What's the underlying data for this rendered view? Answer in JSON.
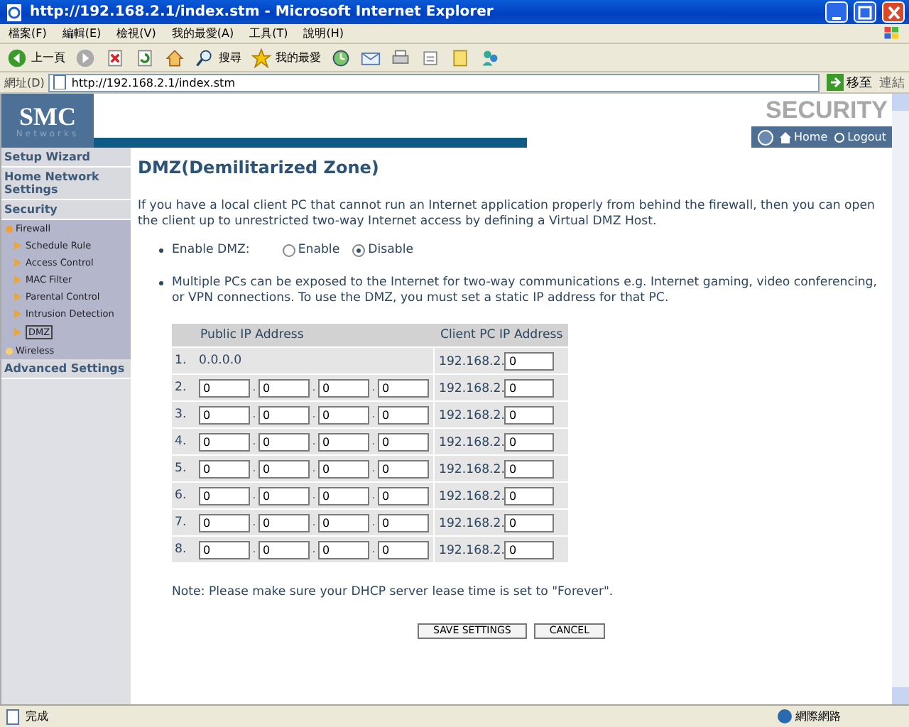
{
  "window": {
    "title": "http://192.168.2.1/index.stm - Microsoft Internet Explorer"
  },
  "menu": [
    "檔案(F)",
    "編輯(E)",
    "檢視(V)",
    "我的最愛(A)",
    "工具(T)",
    "說明(H)"
  ],
  "toolbar": [
    {
      "kind": "back",
      "label": "上一頁"
    },
    {
      "kind": "forward"
    },
    {
      "kind": "stop"
    },
    {
      "kind": "refresh"
    },
    {
      "kind": "home"
    },
    {
      "kind": "search",
      "label": "搜尋"
    },
    {
      "kind": "favorites",
      "label": "我的最愛"
    },
    {
      "kind": "history"
    },
    {
      "kind": "mail"
    },
    {
      "kind": "print"
    },
    {
      "kind": "edit"
    },
    {
      "kind": "discuss"
    },
    {
      "kind": "messenger"
    }
  ],
  "address": {
    "label": "網址(D)",
    "value": "http://192.168.2.1/index.stm",
    "go": "移至",
    "links": "連結"
  },
  "header": {
    "logo": "SMC",
    "logo_sub": "Networks",
    "banner": "SECURITY",
    "links": [
      "Home",
      "Logout"
    ]
  },
  "sidebar": [
    {
      "label": "Setup Wizard"
    },
    {
      "label": "Home Network Settings"
    },
    {
      "label": "Security",
      "children": [
        {
          "label": "Firewall",
          "expanded": true,
          "children": [
            {
              "label": "Schedule Rule",
              "selected": false
            },
            {
              "label": "Access Control",
              "selected": false
            },
            {
              "label": "MAC Filter",
              "selected": false
            },
            {
              "label": "Parental Control",
              "selected": false
            },
            {
              "label": "Intrusion Detection",
              "selected": false
            },
            {
              "label": "DMZ",
              "selected": true
            }
          ]
        },
        {
          "label": "Wireless",
          "expanded": false
        }
      ]
    },
    {
      "label": "Advanced Settings"
    }
  ],
  "content": {
    "title": "DMZ(Demilitarized Zone)",
    "intro": "If you have a local client PC that cannot run an Internet application properly from behind the firewall, then you can open the client up to unrestricted two-way Internet access by defining a Virtual DMZ Host.",
    "enable_dmz": {
      "label": "Enable DMZ:",
      "options": [
        {
          "label": "Enable",
          "selected": false
        },
        {
          "label": "Disable",
          "selected": true
        }
      ]
    },
    "info": "Multiple PCs can be exposed to the Internet for two-way communications e.g. Internet gaming, video conferencing, or VPN connections.  To use the DMZ, you must set a static IP address for that PC.",
    "table": {
      "separator": ".",
      "columns": [
        "Public IP Address",
        "Client PC IP Address"
      ],
      "rows": [
        {
          "index": "1.",
          "kind": "text",
          "public": "0.0.0.0",
          "client_prefix": "192.168.2.",
          "client": "0"
        },
        {
          "index": "2.",
          "kind": "fields",
          "public": [
            "0",
            "0",
            "0",
            "0"
          ],
          "client_prefix": "192.168.2.",
          "client": "0"
        },
        {
          "index": "3.",
          "kind": "fields",
          "public": [
            "0",
            "0",
            "0",
            "0"
          ],
          "client_prefix": "192.168.2.",
          "client": "0"
        },
        {
          "index": "4.",
          "kind": "fields",
          "public": [
            "0",
            "0",
            "0",
            "0"
          ],
          "client_prefix": "192.168.2.",
          "client": "0"
        },
        {
          "index": "5.",
          "kind": "fields",
          "public": [
            "0",
            "0",
            "0",
            "0"
          ],
          "client_prefix": "192.168.2.",
          "client": "0"
        },
        {
          "index": "6.",
          "kind": "fields",
          "public": [
            "0",
            "0",
            "0",
            "0"
          ],
          "client_prefix": "192.168.2.",
          "client": "0"
        },
        {
          "index": "7.",
          "kind": "fields",
          "public": [
            "0",
            "0",
            "0",
            "0"
          ],
          "client_prefix": "192.168.2.",
          "client": "0"
        },
        {
          "index": "8.",
          "kind": "fields",
          "public": [
            "0",
            "0",
            "0",
            "0"
          ],
          "client_prefix": "192.168.2.",
          "client": "0"
        }
      ]
    },
    "note": "Note: Please make sure your DHCP server lease time is set to \"Forever\".",
    "buttons": [
      "SAVE SETTINGS",
      "CANCEL"
    ]
  },
  "status_bar": {
    "text": "完成",
    "zone": "網際網路"
  }
}
